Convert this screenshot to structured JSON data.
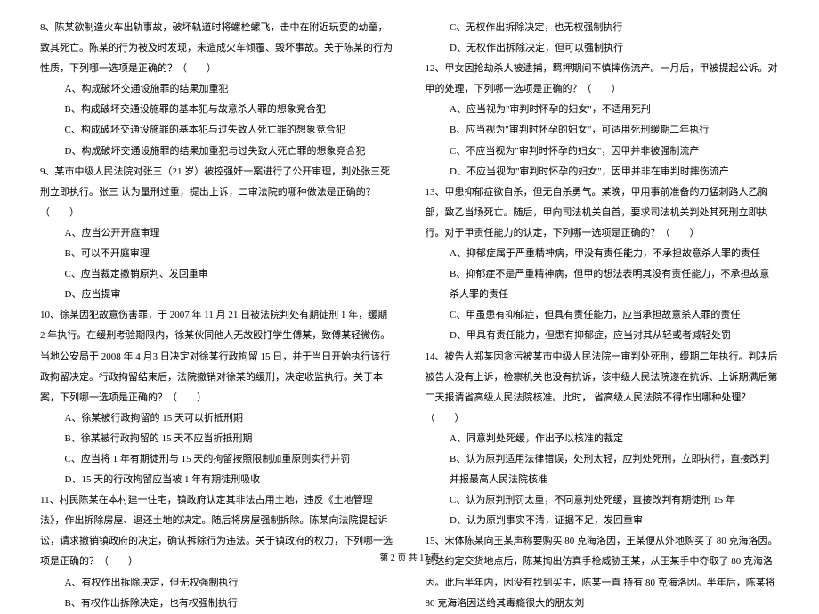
{
  "left": {
    "q8": {
      "stem": "8、陈某欲制造火车出轨事故，破坏轨道时将螺栓螺飞，击中在附近玩耍的幼童，致其死亡。陈某的行为被及时发现，未造成火车倾覆、毁坏事故。关于陈某的行为性质，下列哪一选项是正确的？（　　）",
      "a": "A、构成破坏交通设施罪的结果加重犯",
      "b": "B、构成破坏交通设施罪的基本犯与故意杀人罪的想象竞合犯",
      "c": "C、构成破坏交通设施罪的基本犯与过失致人死亡罪的想象竞合犯",
      "d": "D、构成破坏交通设施罪的结果加重犯与过失致人死亡罪的想象竞合犯"
    },
    "q9": {
      "stem": "9、某市中级人民法院对张三（21 岁）被控强奸一案进行了公开审理，判处张三死刑立即执行。张三 认为量刑过重，提出上诉，二审法院的哪种做法是正确的？（　　）",
      "a": "A、应当公开开庭审理",
      "b": "B、可以不开庭审理",
      "c": "C、应当裁定撤销原判、发回重审",
      "d": "D、应当提审"
    },
    "q10": {
      "stem": "10、徐某因犯故意伤害罪，于 2007 年 11 月 21 日被法院判处有期徒刑 1 年，缓期 2 年执行。在缓刑考验期限内，徐某伙同他人无故殴打学生傅某，致傅某轻微伤。当地公安局于 2008 年 4 月3 日决定对徐某行政拘留 15 日，并于当日开始执行该行政拘留决定。行政拘留结束后，法院撤销对徐某的缓刑，决定收监执行。关于本案，下列哪一选项是正确的？（　　）",
      "a": "A、徐某被行政拘留的 15 天可以折抵刑期",
      "b": "B、徐某被行政拘留的 15 天不应当折抵刑期",
      "c": "C、应当将 1 年有期徒刑与 15 天的拘留按照限制加重原则实行并罚",
      "d": "D、15 天的行政拘留应当被 1 年有期徒刑吸收"
    },
    "q11": {
      "stem": "11、村民陈某在本村建一住宅，镇政府认定其非法占用土地，违反《土地管理法》，作出拆除房屋、退还土地的决定。随后将房屋强制拆除。陈某向法院提起诉讼，请求撤销镇政府的决定，确认拆除行为违法。关于镇政府的权力，下列哪一选项是正确的？（　　）",
      "a": "A、有权作出拆除决定，但无权强制执行",
      "b": "B、有权作出拆除决定，也有权强制执行"
    }
  },
  "right": {
    "q11c": {
      "c": "C、无权作出拆除决定，也无权强制执行",
      "d": "D、无权作出拆除决定，但可以强制执行"
    },
    "q12": {
      "stem": "12、甲女因抢劫杀人被逮捕，羁押期间不慎摔伤流产。一月后，甲被提起公诉。对甲的处理，下列哪一选项是正确的？（　　）",
      "a": "A、应当视为\"审判时怀孕的妇女\"，不适用死刑",
      "b": "B、应当视为\"审判时怀孕的妇女\"，可适用死刑缓期二年执行",
      "c": "C、不应当视为\"审判时怀孕的妇女\"，因甲并非被强制流产",
      "d": "D、不应当视为\"审判时怀孕的妇女\"，因甲并非在审判时摔伤流产"
    },
    "q13": {
      "stem": "13、甲患抑郁症欲自杀，但无自杀勇气。某晚，甲用事前准备的刀猛刺路人乙胸部，致乙当场死亡。随后，甲向司法机关自首，要求司法机关判处其死刑立即执行。对于甲责任能力的认定，下列哪一选项是正确的？（　　）",
      "a": "A、抑郁症属于严重精神病，甲没有责任能力，不承担故意杀人罪的责任",
      "b": "B、抑郁症不是严重精神病，但甲的想法表明其没有责任能力，不承担故意杀人罪的责任",
      "c": "C、甲虽患有抑郁症，但具有责任能力，应当承担故意杀人罪的责任",
      "d": "D、甲具有责任能力，但患有抑郁症，应当对其从轻或者减轻处罚"
    },
    "q14": {
      "stem": "14、被告人郑某因贪污被某市中级人民法院一审判处死刑，缓期二年执行。判决后被告人没有上诉，检察机关也没有抗诉，该中级人民法院遂在抗诉、上诉期满后第二天报请省高级人民法院核准。此时， 省高级人民法院不得作出哪种处理？（　　）",
      "a": "A、同意判处死缓，作出予以核准的裁定",
      "b": "B、认为原判适用法律错误，处刑太轻，应判处死刑，立即执行，直接改判并报最高人民法院核准",
      "c": "C、认为原判刑罚太重，不同意判处死缓，直接改判有期徒刑 15 年",
      "d": "D、认为原判事实不清，证据不足，发回重审"
    },
    "q15": {
      "stem": "15、宋体陈某向王某声称要购买 80 克海洛因，王某便从外地购买了 80 克海洛因。到达约定交货地点后，陈某掏出仿真手枪威胁王某，从王某手中夺取了 80 克海洛因。此后半年内，因没有找到买主，陈某一直 持有 80 克海洛因。半年后，陈某将 80 克海洛因送给其毒瘾很大的朋友刘"
    }
  },
  "footer": "第 2 页 共 17 页"
}
